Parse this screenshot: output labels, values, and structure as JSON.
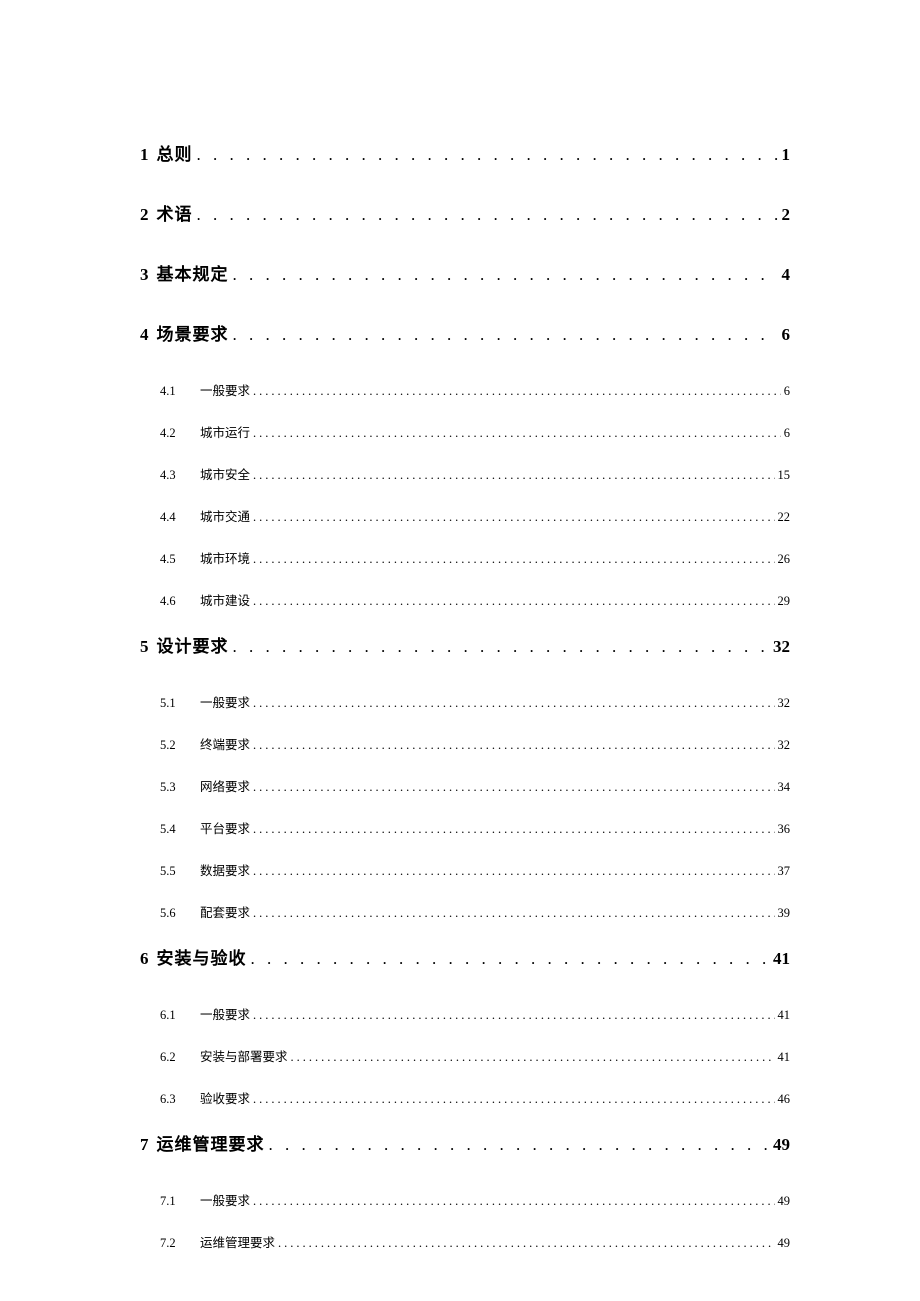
{
  "toc": [
    {
      "num": "1",
      "title": "总则",
      "page": "1",
      "children": []
    },
    {
      "num": "2",
      "title": "术语",
      "page": "2",
      "children": []
    },
    {
      "num": "3",
      "title": "基本规定",
      "page": "4",
      "children": []
    },
    {
      "num": "4",
      "title": "场景要求",
      "page": "6",
      "children": [
        {
          "num": "4.1",
          "title": "一般要求",
          "page": "6"
        },
        {
          "num": "4.2",
          "title": "城市运行",
          "page": "6"
        },
        {
          "num": "4.3",
          "title": "城市安全",
          "page": "15"
        },
        {
          "num": "4.4",
          "title": "城市交通",
          "page": "22"
        },
        {
          "num": "4.5",
          "title": "城市环境",
          "page": "26"
        },
        {
          "num": "4.6",
          "title": "城市建设",
          "page": "29"
        }
      ]
    },
    {
      "num": "5",
      "title": "设计要求",
      "page": "32",
      "children": [
        {
          "num": "5.1",
          "title": "一般要求",
          "page": "32"
        },
        {
          "num": "5.2",
          "title": "终端要求",
          "page": "32"
        },
        {
          "num": "5.3",
          "title": "网络要求",
          "page": "34"
        },
        {
          "num": "5.4",
          "title": "平台要求",
          "page": "36"
        },
        {
          "num": "5.5",
          "title": "数据要求",
          "page": "37"
        },
        {
          "num": "5.6",
          "title": "配套要求",
          "page": "39"
        }
      ]
    },
    {
      "num": "6",
      "title": "安装与验收",
      "page": "41",
      "children": [
        {
          "num": "6.1",
          "title": "一般要求",
          "page": "41"
        },
        {
          "num": "6.2",
          "title": "安装与部署要求",
          "page": "41"
        },
        {
          "num": "6.3",
          "title": "验收要求",
          "page": "46"
        }
      ]
    },
    {
      "num": "7",
      "title": "运维管理要求",
      "page": "49",
      "children": [
        {
          "num": "7.1",
          "title": "一般要求",
          "page": "49"
        },
        {
          "num": "7.2",
          "title": "运维管理要求",
          "page": "49"
        }
      ]
    }
  ],
  "dots_l1": ". . . . . . . . . . . . . . . . . . . . . . . . . . . . . . . . . . . . . . . . . . . . . . . . . . . . . . . . . . . . . . . . . . . . . . . . . . . . . . . . . . . . . . . . . . . . . . . . . . . .",
  "dots_l2": "..................................................................................................................................................."
}
